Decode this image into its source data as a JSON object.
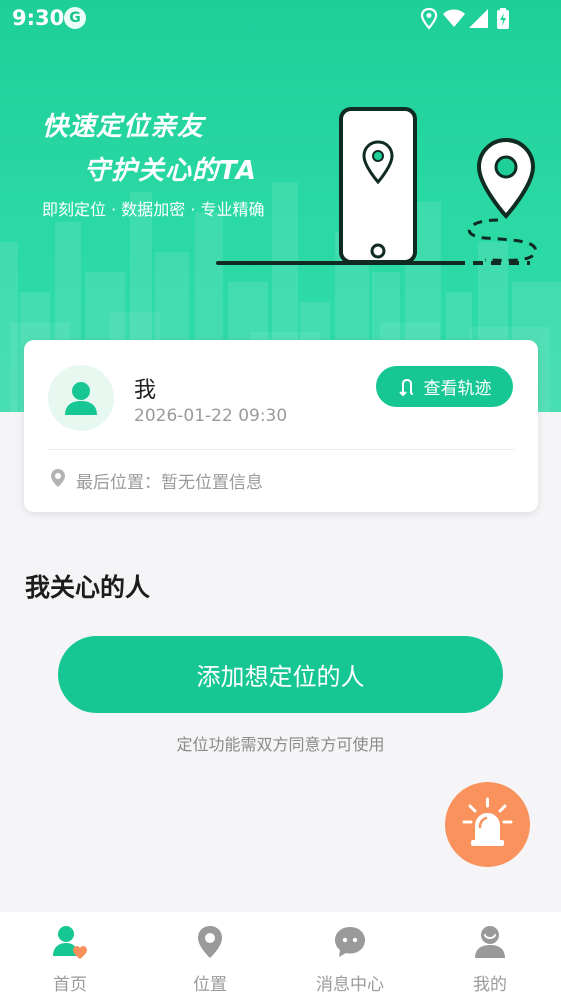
{
  "status_bar": {
    "time": "9:30",
    "app_badge": "G"
  },
  "hero": {
    "slogan_line1": "快速定位亲友",
    "slogan_line2": "守护关心的TA",
    "subtitle": "即刻定位 · 数据加密 · 专业精确"
  },
  "profile_card": {
    "name": "我",
    "timestamp": "2026-01-22 09:30",
    "track_button": "查看轨迹",
    "last_location": "最后位置：暂无位置信息"
  },
  "care_section": {
    "title": "我关心的人",
    "add_button": "添加想定位的人",
    "hint": "定位功能需双方同意方可使用"
  },
  "tabbar": {
    "items": [
      {
        "label": "首页",
        "icon": "person-heart-icon",
        "active": true
      },
      {
        "label": "位置",
        "icon": "location-pin-icon",
        "active": false
      },
      {
        "label": "消息中心",
        "icon": "chat-bubble-icon",
        "active": false
      },
      {
        "label": "我的",
        "icon": "profile-icon",
        "active": false
      }
    ]
  },
  "colors": {
    "primary": "#17c793",
    "hero_green": "#2ad9a4",
    "sos_orange": "#f9925d",
    "inactive_tab": "#9a9a9a"
  }
}
